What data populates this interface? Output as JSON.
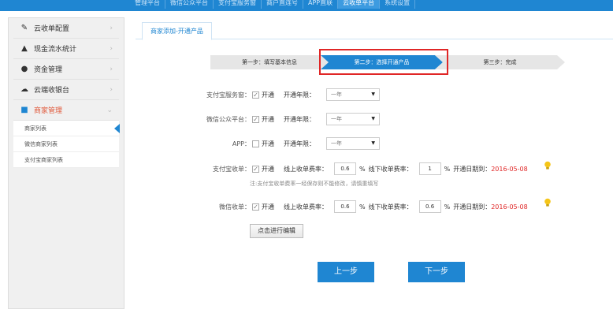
{
  "topnav": [
    "管理平台",
    "微信公众平台",
    "支付宝服务窗",
    "商户直连号",
    "APP直联",
    "云收单平台",
    "系统设置"
  ],
  "sidebar": {
    "items": [
      {
        "label": "云收单配置",
        "icon": "gear-icon"
      },
      {
        "label": "现金流水统计",
        "icon": "flask-icon"
      },
      {
        "label": "资金管理",
        "icon": "money-bag-icon"
      },
      {
        "label": "云端收银台",
        "icon": "cloud-icon"
      },
      {
        "label": "商家管理",
        "icon": "merchant-icon"
      }
    ],
    "submenu": [
      "商家列表",
      "微信商家列表",
      "支付宝商家列表"
    ]
  },
  "tab": {
    "label": "商家添加-开通产品"
  },
  "steps": [
    "第一步：填写基本信息",
    "第二步：选择开通产品",
    "第三步：完成"
  ],
  "form": {
    "alipay_service": {
      "label": "支付宝服务窗：",
      "open": "开通",
      "years_label": "开通年限：",
      "years_value": "一年"
    },
    "wechat_platform": {
      "label": "微信公众平台：",
      "open": "开通",
      "years_label": "开通年限：",
      "years_value": "一年"
    },
    "app": {
      "label": "APP：",
      "open": "开通",
      "years_label": "开通年限：",
      "years_value": "一年"
    },
    "alipay_pay": {
      "label": "支付宝收单：",
      "open": "开通",
      "online_label": "线上收单费率：",
      "online_value": "0.6",
      "pct": "%",
      "offline_label": "线下收单费率：",
      "offline_value": "1",
      "date_label": "开通日期到：",
      "date_value": "2016-05-08"
    },
    "note": "注:支付宝收单费率一经保存则不能修改，请慎重填写",
    "wechat_pay": {
      "label": "微信收单：",
      "open": "开通",
      "online_label": "线上收单费率：",
      "online_value": "0.6",
      "pct": "%",
      "offline_label": "线下收单费率：",
      "offline_value": "0.6",
      "date_label": "开通日期到：",
      "date_value": "2016-05-08"
    }
  },
  "buttons": {
    "edit": "点击进行编辑",
    "prev": "上一步",
    "next": "下一步"
  }
}
